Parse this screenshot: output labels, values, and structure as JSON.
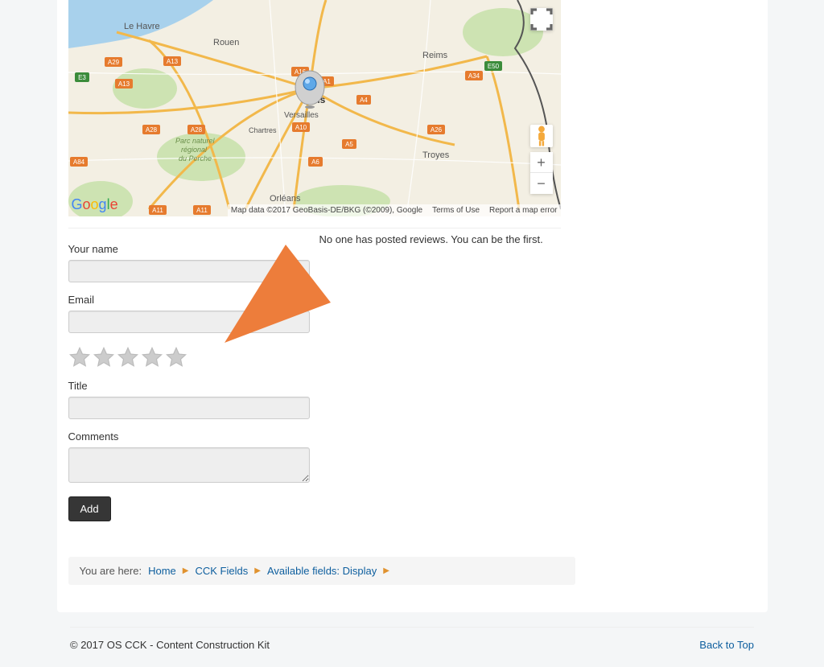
{
  "map": {
    "attribution": "Map data ©2017 GeoBasis-DE/BKG (©2009), Google",
    "terms": "Terms of Use",
    "report": "Report a map error",
    "cities": {
      "paris": "Paris",
      "versailles": "Versailles",
      "orleans": "Orléans",
      "rouen": "Rouen",
      "lehavre": "Le Havre",
      "reims": "Reims",
      "troyes": "Troyes",
      "chartres": "Chartres"
    },
    "region": "Parc naturel\nrégional\ndu Perche",
    "roads": {
      "a13": "A13",
      "a16": "A16",
      "a1": "A1",
      "a4": "A4",
      "a5": "A5",
      "a6": "A6",
      "a10": "A10",
      "a11": "A11",
      "a28": "A28",
      "a29": "A29",
      "a84": "A84",
      "a26": "A26",
      "e3": "E3",
      "e50": "E50",
      "a34": "A34"
    }
  },
  "reviews": {
    "empty_msg": "No one has posted reviews. You can be the first."
  },
  "form": {
    "name_label": "Your name",
    "email_label": "Email",
    "title_label": "Title",
    "comments_label": "Comments",
    "submit": "Add"
  },
  "breadcrumb": {
    "label": "You are here:",
    "items": [
      "Home",
      "CCK Fields",
      "Available fields: Display"
    ]
  },
  "footer": {
    "copyright": "© 2017 OS CCK - Content Construction Kit",
    "back_to_top": "Back to Top"
  }
}
